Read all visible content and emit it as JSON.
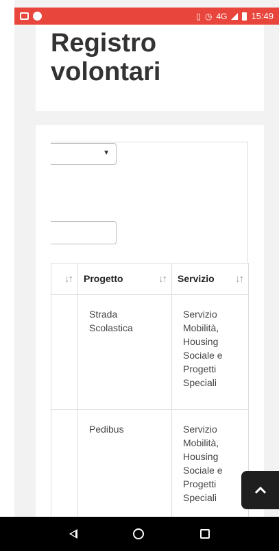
{
  "status_bar": {
    "time": "15:49",
    "network": "4G"
  },
  "page": {
    "title_line1": "Registro",
    "title_line2": "volontari"
  },
  "filters": {
    "select_value": "",
    "search_value": ""
  },
  "table": {
    "headers": [
      "",
      "Progetto",
      "Servizio"
    ],
    "rows": [
      {
        "progetto": "Strada Scolastica",
        "servizio": "Servizio Mobilità, Housing Sociale e Progetti Speciali"
      },
      {
        "progetto": "Pedibus",
        "servizio": "Servizio Mobilità, Housing Sociale e Progetti Speciali"
      }
    ]
  },
  "colors": {
    "status_bar": "#e8463c",
    "nav_bar": "#000000",
    "scroll_top_button": "#1f1f1f"
  }
}
